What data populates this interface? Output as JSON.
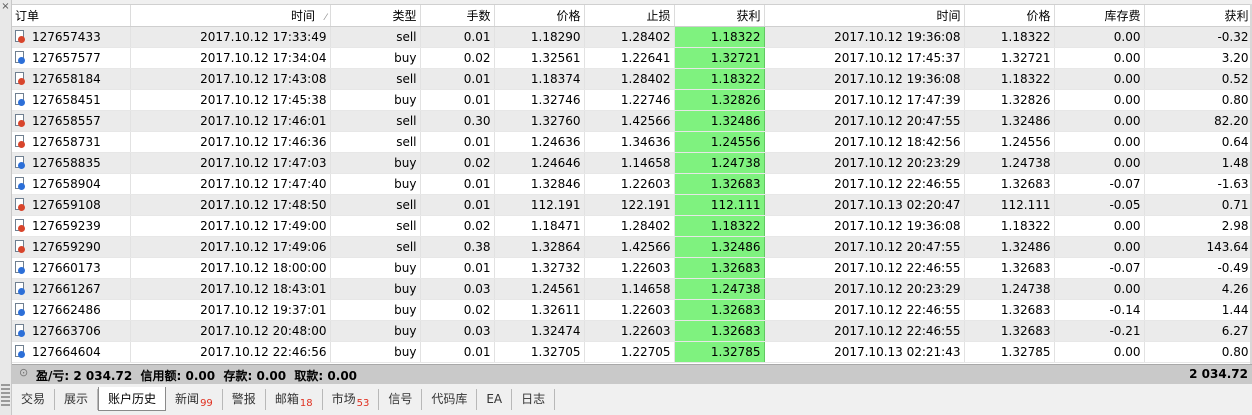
{
  "columns": {
    "order": "订单",
    "open_time": "时间",
    "type": "类型",
    "lots": "手数",
    "open_price": "价格",
    "sl": "止损",
    "tp": "获利",
    "close_time": "时间",
    "close_price": "价格",
    "swap": "库存费",
    "profit": "获利"
  },
  "rows": [
    [
      "127657433",
      "2017.10.12 17:33:49",
      "sell",
      "0.01",
      "1.18290",
      "1.28402",
      "1.18322",
      "2017.10.12 19:36:08",
      "1.18322",
      "0.00",
      "-0.32"
    ],
    [
      "127657577",
      "2017.10.12 17:34:04",
      "buy",
      "0.02",
      "1.32561",
      "1.22641",
      "1.32721",
      "2017.10.12 17:45:37",
      "1.32721",
      "0.00",
      "3.20"
    ],
    [
      "127658184",
      "2017.10.12 17:43:08",
      "sell",
      "0.01",
      "1.18374",
      "1.28402",
      "1.18322",
      "2017.10.12 19:36:08",
      "1.18322",
      "0.00",
      "0.52"
    ],
    [
      "127658451",
      "2017.10.12 17:45:38",
      "buy",
      "0.01",
      "1.32746",
      "1.22746",
      "1.32826",
      "2017.10.12 17:47:39",
      "1.32826",
      "0.00",
      "0.80"
    ],
    [
      "127658557",
      "2017.10.12 17:46:01",
      "sell",
      "0.30",
      "1.32760",
      "1.42566",
      "1.32486",
      "2017.10.12 20:47:55",
      "1.32486",
      "0.00",
      "82.20"
    ],
    [
      "127658731",
      "2017.10.12 17:46:36",
      "sell",
      "0.01",
      "1.24636",
      "1.34636",
      "1.24556",
      "2017.10.12 18:42:56",
      "1.24556",
      "0.00",
      "0.64"
    ],
    [
      "127658835",
      "2017.10.12 17:47:03",
      "buy",
      "0.02",
      "1.24646",
      "1.14658",
      "1.24738",
      "2017.10.12 20:23:29",
      "1.24738",
      "0.00",
      "1.48"
    ],
    [
      "127658904",
      "2017.10.12 17:47:40",
      "buy",
      "0.01",
      "1.32846",
      "1.22603",
      "1.32683",
      "2017.10.12 22:46:55",
      "1.32683",
      "-0.07",
      "-1.63"
    ],
    [
      "127659108",
      "2017.10.12 17:48:50",
      "sell",
      "0.01",
      "112.191",
      "122.191",
      "112.111",
      "2017.10.13 02:20:47",
      "112.111",
      "-0.05",
      "0.71"
    ],
    [
      "127659239",
      "2017.10.12 17:49:00",
      "sell",
      "0.02",
      "1.18471",
      "1.28402",
      "1.18322",
      "2017.10.12 19:36:08",
      "1.18322",
      "0.00",
      "2.98"
    ],
    [
      "127659290",
      "2017.10.12 17:49:06",
      "sell",
      "0.38",
      "1.32864",
      "1.42566",
      "1.32486",
      "2017.10.12 20:47:55",
      "1.32486",
      "0.00",
      "143.64"
    ],
    [
      "127660173",
      "2017.10.12 18:00:00",
      "buy",
      "0.01",
      "1.32732",
      "1.22603",
      "1.32683",
      "2017.10.12 22:46:55",
      "1.32683",
      "-0.07",
      "-0.49"
    ],
    [
      "127661267",
      "2017.10.12 18:43:01",
      "buy",
      "0.03",
      "1.24561",
      "1.14658",
      "1.24738",
      "2017.10.12 20:23:29",
      "1.24738",
      "0.00",
      "4.26"
    ],
    [
      "127662486",
      "2017.10.12 19:37:01",
      "buy",
      "0.02",
      "1.32611",
      "1.22603",
      "1.32683",
      "2017.10.12 22:46:55",
      "1.32683",
      "-0.14",
      "1.44"
    ],
    [
      "127663706",
      "2017.10.12 20:48:00",
      "buy",
      "0.03",
      "1.32474",
      "1.22603",
      "1.32683",
      "2017.10.12 22:46:55",
      "1.32683",
      "-0.21",
      "6.27"
    ],
    [
      "127664604",
      "2017.10.12 22:46:56",
      "buy",
      "0.01",
      "1.32705",
      "1.22705",
      "1.32785",
      "2017.10.13 02:21:43",
      "1.32785",
      "0.00",
      "0.80"
    ]
  ],
  "summary": {
    "text": "盈/亏: 2 034.72  信用额: 0.00  存款: 0.00  取款: 0.00",
    "total": "2 034.72"
  },
  "tabs": [
    {
      "label": "交易",
      "badge": ""
    },
    {
      "label": "展示",
      "badge": ""
    },
    {
      "label": "账户历史",
      "badge": "",
      "active": true
    },
    {
      "label": "新闻",
      "badge": "99"
    },
    {
      "label": "警报",
      "badge": ""
    },
    {
      "label": "邮箱",
      "badge": "18"
    },
    {
      "label": "市场",
      "badge": "53"
    },
    {
      "label": "信号",
      "badge": ""
    },
    {
      "label": "代码库",
      "badge": ""
    },
    {
      "label": "EA",
      "badge": ""
    },
    {
      "label": "日志",
      "badge": ""
    }
  ],
  "colors": {
    "tp_highlight": "#7ff27f",
    "sell_icon": "#d8452c",
    "buy_icon": "#2c6fd8",
    "badge": "#e03020"
  }
}
